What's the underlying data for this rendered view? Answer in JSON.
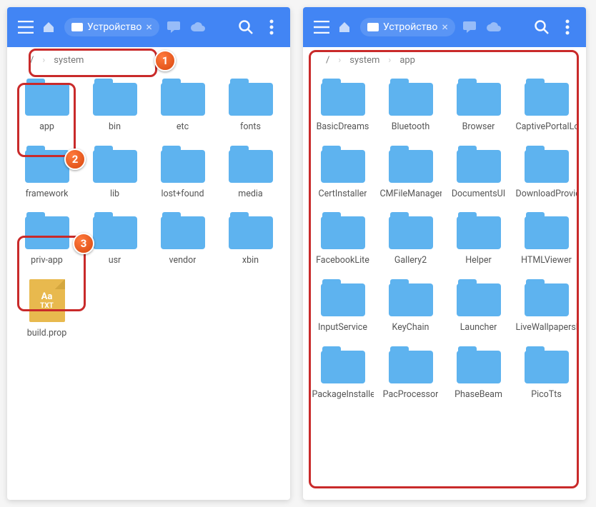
{
  "left": {
    "appbar": {
      "tab_label": "Устройство"
    },
    "breadcrumb": [
      "/",
      "system"
    ],
    "items": [
      {
        "type": "folder",
        "label": "app"
      },
      {
        "type": "folder",
        "label": "bin"
      },
      {
        "type": "folder",
        "label": "etc"
      },
      {
        "type": "folder",
        "label": "fonts"
      },
      {
        "type": "folder",
        "label": "framework"
      },
      {
        "type": "folder",
        "label": "lib"
      },
      {
        "type": "folder",
        "label": "lost+found"
      },
      {
        "type": "folder",
        "label": "media"
      },
      {
        "type": "folder",
        "label": "priv-app"
      },
      {
        "type": "folder",
        "label": "usr"
      },
      {
        "type": "folder",
        "label": "vendor"
      },
      {
        "type": "folder",
        "label": "xbin"
      },
      {
        "type": "file",
        "label": "build.prop",
        "badge_top": "Aa",
        "badge_bot": "TXT"
      }
    ],
    "callouts": {
      "1": "1",
      "2": "2",
      "3": "3"
    }
  },
  "right": {
    "appbar": {
      "tab_label": "Устройство"
    },
    "breadcrumb": [
      "/",
      "system",
      "app"
    ],
    "items": [
      {
        "type": "folder",
        "label": "BasicDreams"
      },
      {
        "type": "folder",
        "label": "Bluetooth"
      },
      {
        "type": "folder",
        "label": "Browser"
      },
      {
        "type": "folder",
        "label": "CaptivePortalLogin"
      },
      {
        "type": "folder",
        "label": "CertInstaller"
      },
      {
        "type": "folder",
        "label": "CMFileManager"
      },
      {
        "type": "folder",
        "label": "DocumentsUI"
      },
      {
        "type": "folder",
        "label": "DownloadProviderUi"
      },
      {
        "type": "folder",
        "label": "FacebookLite"
      },
      {
        "type": "folder",
        "label": "Gallery2"
      },
      {
        "type": "folder",
        "label": "Helper"
      },
      {
        "type": "folder",
        "label": "HTMLViewer"
      },
      {
        "type": "folder",
        "label": "InputService"
      },
      {
        "type": "folder",
        "label": "KeyChain"
      },
      {
        "type": "folder",
        "label": "Launcher"
      },
      {
        "type": "folder",
        "label": "LiveWallpapersPicker"
      },
      {
        "type": "folder",
        "label": "PackageInstaller"
      },
      {
        "type": "folder",
        "label": "PacProcessor"
      },
      {
        "type": "folder",
        "label": "PhaseBeam"
      },
      {
        "type": "folder",
        "label": "PicoTts"
      }
    ]
  }
}
